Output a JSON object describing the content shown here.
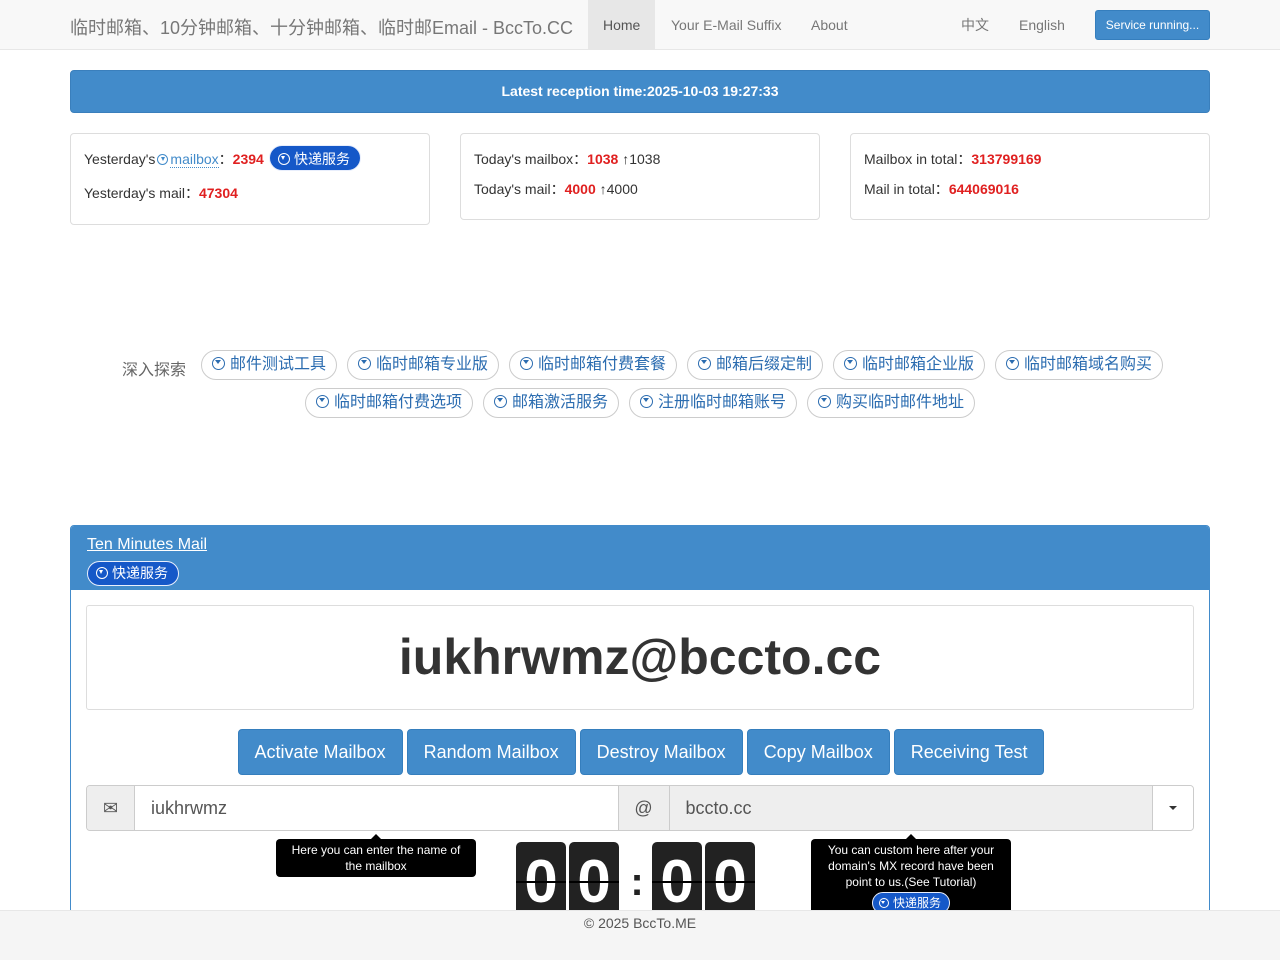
{
  "navbar": {
    "brand": "临时邮箱、10分钟邮箱、十分钟邮箱、临时邮Email - BccTo.CC",
    "links": [
      "Home",
      "Your E-Mail Suffix",
      "About"
    ],
    "lang_zh": "中文",
    "lang_en": "English",
    "status_button": "Service running..."
  },
  "banner": {
    "text": "Latest reception time:2025-10-03 19:27:33"
  },
  "stats": {
    "yesterday_mailbox_prefix": "Yesterday's",
    "yesterday_mailbox_link": "mailbox",
    "yesterday_mailbox_sep": "：",
    "yesterday_mailbox_value": "2394",
    "express_service": "快递服务",
    "yesterday_mail_label": "Yesterday's mail：",
    "yesterday_mail_value": "47304",
    "today_mailbox_label": "Today's mailbox：",
    "today_mailbox_value": "1038",
    "today_mailbox_up": "↑1038",
    "today_mail_label": "Today's mail：",
    "today_mail_value": "4000",
    "today_mail_up": "↑4000",
    "total_mailbox_label": "Mailbox in total：",
    "total_mailbox_value": "313799169",
    "total_mail_label": "Mail in total：",
    "total_mail_value": "644069016"
  },
  "explore": {
    "label": "深入探索",
    "tags": [
      "邮件测试工具",
      "临时邮箱专业版",
      "临时邮箱付费套餐",
      "邮箱后缀定制",
      "临时邮箱企业版",
      "临时邮箱域名购买",
      "临时邮箱付费选项",
      "邮箱激活服务",
      "注册临时邮箱账号",
      "购买临时邮件地址"
    ]
  },
  "main": {
    "title": "Ten Minutes Mail",
    "express_service": "快递服务",
    "address": "iukhrwmz@bccto.cc",
    "buttons": [
      "Activate Mailbox",
      "Random Mailbox",
      "Destroy Mailbox",
      "Copy Mailbox",
      "Receiving Test"
    ],
    "mail_icon": "✉",
    "name_value": "iukhrwmz",
    "at_sign": "@",
    "domain_value": "bccto.cc",
    "tooltip_name": "Here you can enter the name of the mailbox",
    "tooltip_domain": "You can custom here after your domain's MX record have been point to us.(See Tutorial)",
    "tooltip_express": "快递服务",
    "timer": [
      "0",
      "0",
      "0",
      "0"
    ],
    "timer_colon": ":"
  },
  "footer": {
    "text": "© 2025 BccTo.ME"
  },
  "colors": {
    "primary": "#428bca",
    "highlight_red": "#e02020",
    "express_pill": "#1558c8"
  },
  "icons": [
    "circle-down-icon",
    "mail-icon",
    "caret-down-icon"
  ]
}
